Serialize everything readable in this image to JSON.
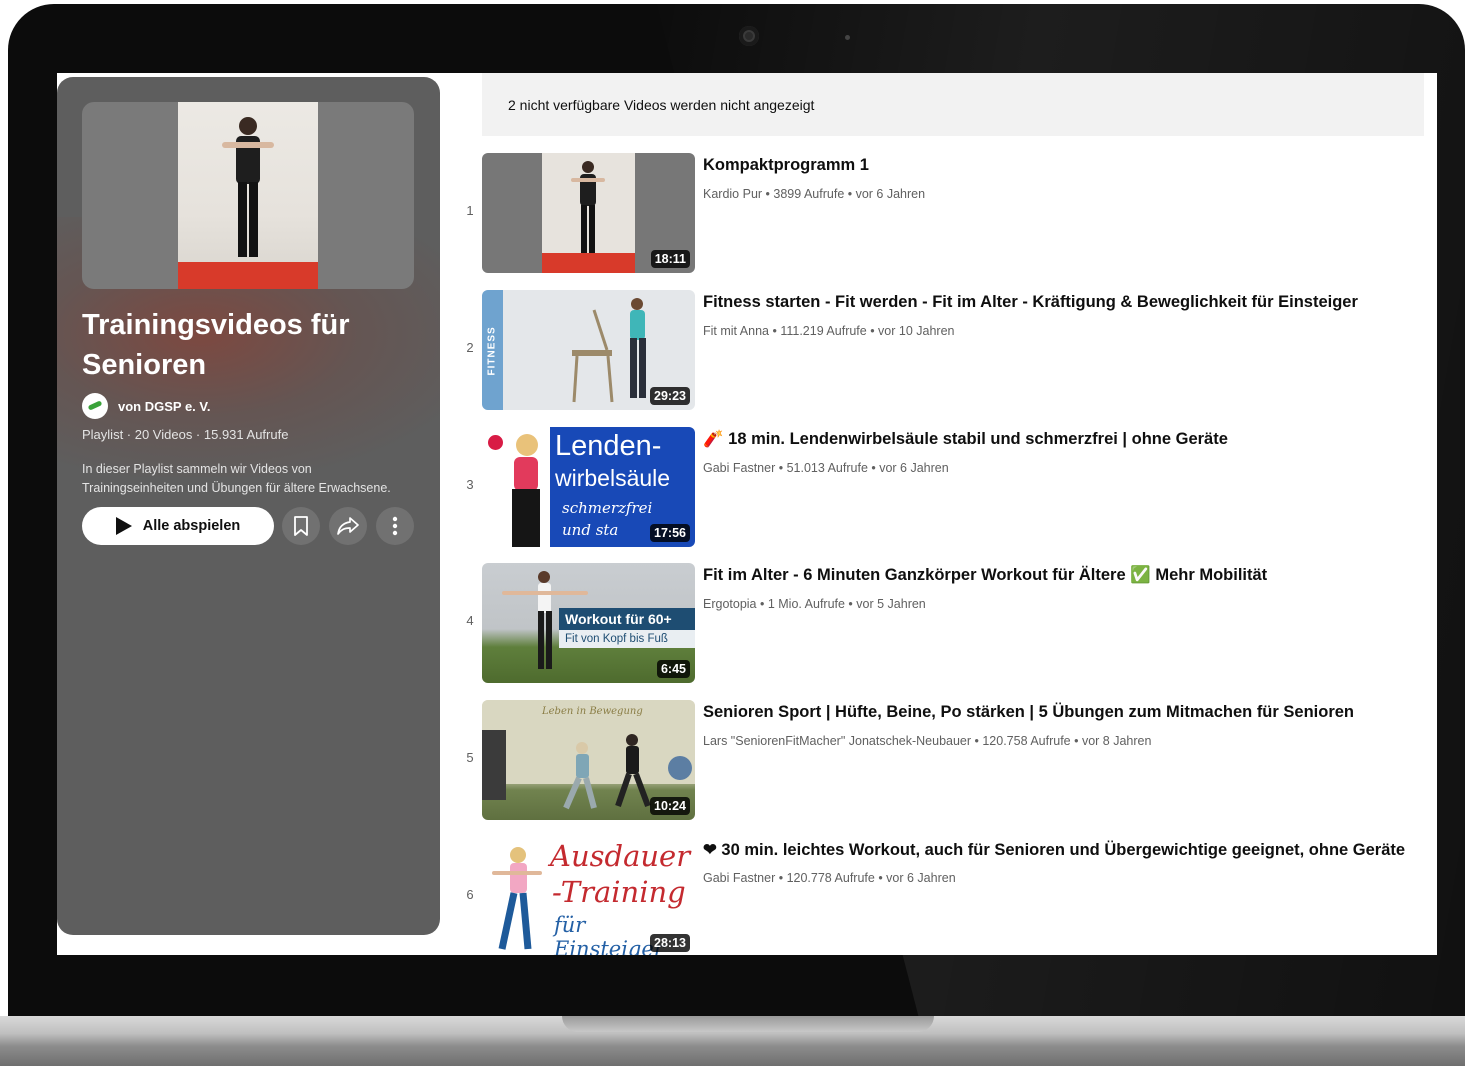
{
  "colors": {
    "panel_bg": "#5e5e5e",
    "notice_bg": "#f2f2f2",
    "text_primary": "#0f0f0f",
    "text_secondary": "#606060"
  },
  "playlist": {
    "title": "Trainingsvideos für Senioren",
    "owner": "von DGSP e. V.",
    "meta": "Playlist · 20 Videos · 15.931 Aufrufe",
    "description": "In dieser Playlist sammeln wir Videos von Trainingseinheiten und Übungen für ältere Erwachsene.",
    "play_all_label": "Alle abspielen",
    "icons": [
      "save-playlist-icon",
      "share-icon",
      "more-vert-icon"
    ]
  },
  "notice": "2 nicht verfügbare Videos werden nicht angezeigt",
  "videos": [
    {
      "index": "1",
      "title": "Kompaktprogramm 1",
      "meta": "Kardio Pur • 3899 Aufrufe • vor 6 Jahren",
      "duration": "18:11"
    },
    {
      "index": "2",
      "title": "Fitness starten - Fit werden - Fit im Alter - Kräftigung & Beweglichkeit für Einsteiger",
      "meta": "Fit mit Anna • 111.219 Aufrufe • vor 10 Jahren",
      "duration": "29:23",
      "thumb_text": "FITNESS"
    },
    {
      "index": "3",
      "title": "18 min. Lendenwirbelsäule stabil und schmerzfrei | ohne Geräte",
      "meta": "Gabi Fastner • 51.013 Aufrufe • vor 6 Jahren",
      "duration": "17:56",
      "emoji": "🧨",
      "thumb_text": [
        "Lenden-",
        "wirbelsäule",
        "schmerzfrei",
        "und sta"
      ]
    },
    {
      "index": "4",
      "title": "Fit im Alter - 6 Minuten Ganzkörper Workout für Ältere ✅ Mehr Mobilität",
      "meta": "Ergotopia • 1 Mio. Aufrufe • vor 5 Jahren",
      "duration": "6:45",
      "thumb_text": [
        "Workout für 60+",
        "Fit von Kopf bis Fuß"
      ]
    },
    {
      "index": "5",
      "title": "Senioren Sport | Hüfte, Beine, Po stärken | 5 Übungen zum Mitmachen für Senioren",
      "meta": "Lars \"SeniorenFitMacher\" Jonatschek-Neubauer • 120.758 Aufrufe • vor 8 Jahren",
      "duration": "10:24",
      "thumb_text": "Leben in Bewegung"
    },
    {
      "index": "6",
      "title": "❤ 30 min. leichtes Workout, auch für Senioren und Übergewichtige geeignet, ohne Geräte",
      "meta": "Gabi Fastner • 120.778 Aufrufe • vor 6 Jahren",
      "duration": "28:13",
      "thumb_text": [
        "Ausdauer",
        "-Training",
        "für Einsteiger"
      ]
    }
  ]
}
